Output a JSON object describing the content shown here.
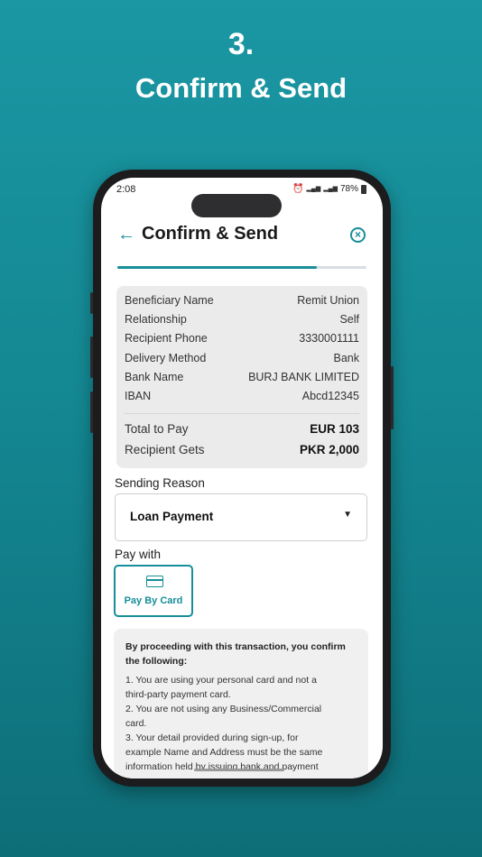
{
  "promo": {
    "step": "3.",
    "title": "Confirm & Send"
  },
  "status_bar": {
    "time": "2:08",
    "battery": "78%"
  },
  "header": {
    "title": "Confirm & Send"
  },
  "progress": {
    "fraction": 0.8
  },
  "summary": {
    "rows": [
      {
        "label": "Beneficiary Name",
        "value": "Remit Union"
      },
      {
        "label": "Relationship",
        "value": "Self"
      },
      {
        "label": "Recipient Phone",
        "value": "3330001111"
      },
      {
        "label": "Delivery Method",
        "value": "Bank"
      },
      {
        "label": "Bank Name",
        "value": "BURJ BANK LIMITED"
      },
      {
        "label": "IBAN",
        "value": "Abcd12345"
      }
    ],
    "total_label": "Total to Pay",
    "total_value": "EUR 103",
    "gets_label": "Recipient Gets",
    "gets_value": "PKR 2,000"
  },
  "sending_reason": {
    "label": "Sending Reason",
    "value": "Loan Payment"
  },
  "pay_with": {
    "label": "Pay with",
    "option": "Pay By Card"
  },
  "terms": {
    "heading": "By proceeding with this transaction, you confirm the following:",
    "lines": [
      "1. You are using your personal card and not a",
      "third-party payment card.",
      "2. You are not using any Business/Commercial",
      "card.",
      "3. Your detail provided during sign-up, for",
      "example Name and Address must be the same",
      "information held by issuing bank and payment"
    ]
  },
  "colors": {
    "accent": "#178e99",
    "background": "#148893"
  }
}
